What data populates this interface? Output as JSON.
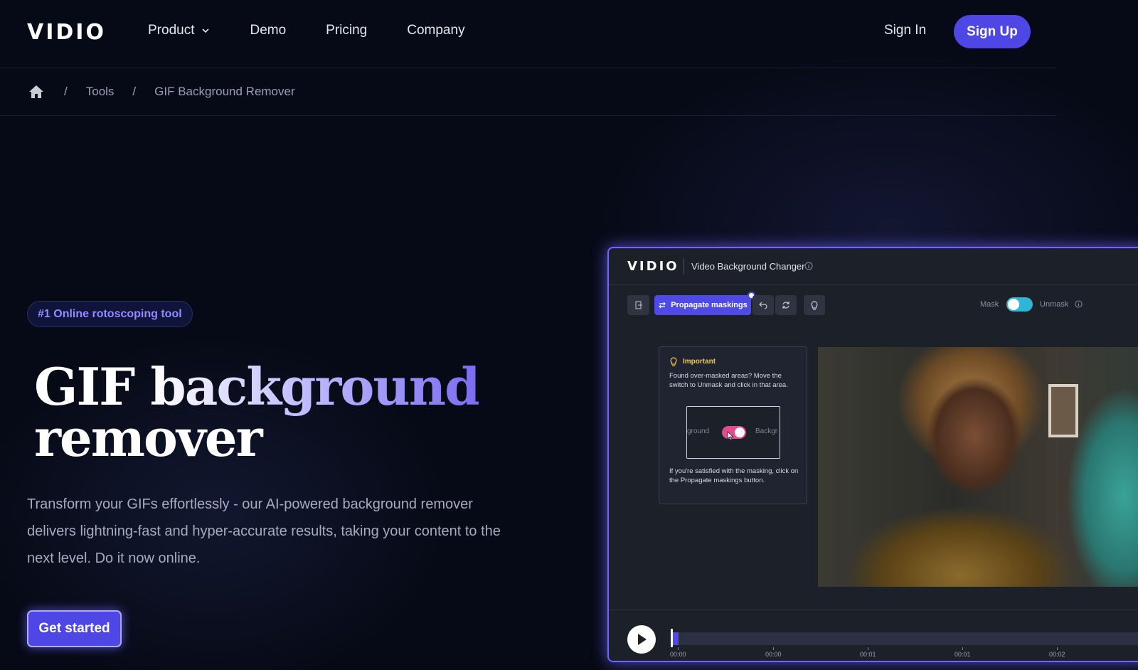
{
  "header": {
    "logo": "VIDIO",
    "nav": [
      "Product",
      "Demo",
      "Pricing",
      "Company"
    ],
    "sign_in": "Sign In",
    "sign_up": "Sign Up"
  },
  "breadcrumb": {
    "separator": "/",
    "items": [
      "Tools",
      "GIF Background Remover"
    ]
  },
  "hero": {
    "badge": "#1 Online rotoscoping tool",
    "title_word1": "GIF ",
    "title_word2": "background",
    "title_line2": "remover",
    "description": "Transform your GIFs effortlessly - our AI-powered background remover delivers lightning-fast and hyper-accurate results, taking your content to the next level. Do it now online.",
    "cta": "Get started"
  },
  "app": {
    "logo": "VIDIO",
    "title": "Video Background Changer",
    "propagate_label": "Propagate maskings",
    "mask_label": "Mask",
    "unmask_label": "Unmask",
    "card": {
      "heading": "Important",
      "text1": "Found over-masked areas? Move the switch to Unmask and click in that area.",
      "preview_left": "ground",
      "preview_right": "Backgr",
      "text2": "If you're satisfied with the masking, click on the Propagate maskings button."
    },
    "timeline_labels": [
      "00:00",
      "00:00",
      "00:01",
      "00:01",
      "00:02"
    ]
  },
  "colors": {
    "background": "#060a16",
    "accent": "#4e46e5",
    "badge_text": "#8f8cff",
    "toggle_on": "#2fb5d6",
    "warning": "#f0c94c"
  }
}
